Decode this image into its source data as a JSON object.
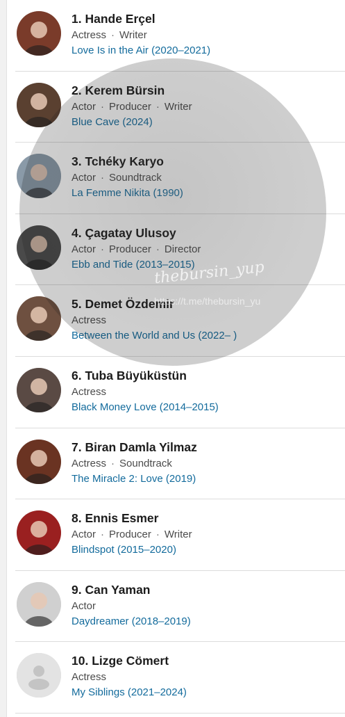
{
  "list": {
    "items": [
      {
        "rank_name": "1. Hande Erçel",
        "roles": [
          "Actress",
          "Writer"
        ],
        "known_for": "Love Is in the Air (2020–2021)",
        "avatar_color": "#7a3b2a"
      },
      {
        "rank_name": "2. Kerem Bürsin",
        "roles": [
          "Actor",
          "Producer",
          "Writer"
        ],
        "known_for": "Blue Cave (2024)",
        "avatar_color": "#5a4030"
      },
      {
        "rank_name": "3. Tchéky Karyo",
        "roles": [
          "Actor",
          "Soundtrack"
        ],
        "known_for": "La Femme Nikita (1990)",
        "avatar_color": "#8a9aa8"
      },
      {
        "rank_name": "4. Çagatay Ulusoy",
        "roles": [
          "Actor",
          "Producer",
          "Director"
        ],
        "known_for": "Ebb and Tide (2013–2015)",
        "avatar_color": "#4a4a4a"
      },
      {
        "rank_name": "5. Demet Özdemir",
        "roles": [
          "Actress"
        ],
        "known_for": "Between the World and Us (2022– )",
        "avatar_color": "#6e5040"
      },
      {
        "rank_name": "6. Tuba Büyüküstün",
        "roles": [
          "Actress"
        ],
        "known_for": "Black Money Love (2014–2015)",
        "avatar_color": "#5a4a44"
      },
      {
        "rank_name": "7. Biran Damla Yilmaz",
        "roles": [
          "Actress",
          "Soundtrack"
        ],
        "known_for": "The Miracle 2: Love (2019)",
        "avatar_color": "#6a3322"
      },
      {
        "rank_name": "8. Ennis Esmer",
        "roles": [
          "Actor",
          "Producer",
          "Writer"
        ],
        "known_for": "Blindspot (2015–2020)",
        "avatar_color": "#9a2020"
      },
      {
        "rank_name": "9. Can Yaman",
        "roles": [
          "Actor"
        ],
        "known_for": "Daydreamer (2018–2019)",
        "avatar_color": "#d0d0d0"
      },
      {
        "rank_name": "10. Lizge Cömert",
        "roles": [
          "Actress"
        ],
        "known_for": "My Siblings (2021–2024)",
        "avatar_color": "#e0e0e0"
      }
    ]
  },
  "watermark": {
    "handle": "thebursin_yup",
    "url": "https://t.me/thebursin_yu"
  },
  "colors": {
    "name": "#1c1c1c",
    "roles": "#4b4b4b",
    "link": "#136b9c",
    "divider": "#dcdcdc"
  }
}
